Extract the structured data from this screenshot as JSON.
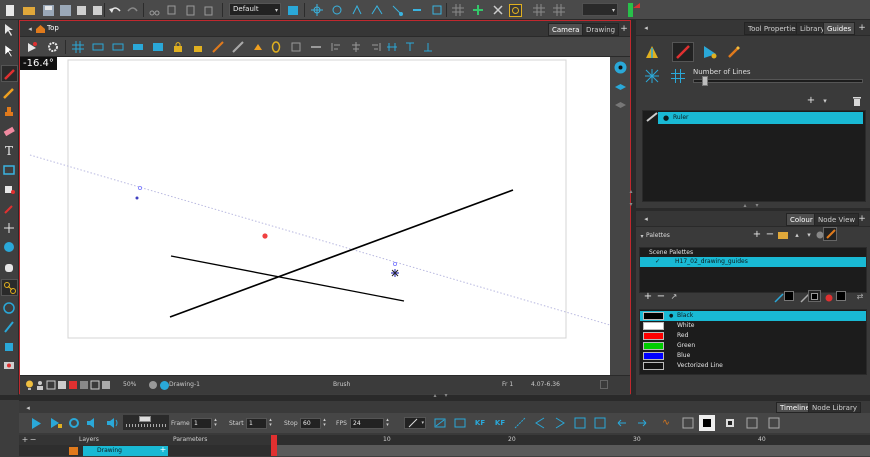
{
  "toolbar": {
    "preset_value": "Default"
  },
  "view": {
    "breadcrumb": "Top",
    "tabs": [
      {
        "label": "Camera",
        "active": true
      },
      {
        "label": "Drawing",
        "active": false
      }
    ],
    "angle_readout": "-16.4°",
    "status": {
      "zoom": "50%",
      "drawing": "Drawing-1",
      "tool": "Brush",
      "frame": "Fr 1",
      "coords": "4.07-6.36"
    }
  },
  "right_top": {
    "tabs": [
      {
        "label": "Tool Properties",
        "active": false
      },
      {
        "label": "Library",
        "active": false
      },
      {
        "label": "Guides",
        "active": true
      }
    ],
    "number_of_lines_label": "Number of Lines",
    "number_of_lines_value": 0.05,
    "guides": [
      {
        "name": "Ruler",
        "selected": true
      }
    ]
  },
  "right_bottom": {
    "tabs": [
      {
        "label": "Colour",
        "active": true
      },
      {
        "label": "Node View",
        "active": false
      }
    ],
    "palettes_label": "Palettes",
    "scene_palettes_label": "Scene Palettes",
    "palettes": [
      {
        "name": "H17_02_drawing_guides",
        "selected": true
      }
    ],
    "colours": [
      {
        "name": "Black",
        "hex": "#000000",
        "selected": true
      },
      {
        "name": "White",
        "hex": "#ffffff",
        "selected": false
      },
      {
        "name": "Red",
        "hex": "#ff0000",
        "selected": false
      },
      {
        "name": "Green",
        "hex": "#00cc00",
        "selected": false
      },
      {
        "name": "Blue",
        "hex": "#0000ff",
        "selected": false
      },
      {
        "name": "Vectorized Line",
        "hex": "#111111",
        "selected": false
      }
    ]
  },
  "timeline": {
    "tabs": [
      {
        "label": "Timeline",
        "active": true
      },
      {
        "label": "Node Library",
        "active": false
      }
    ],
    "frame_label": "Frame",
    "frame_value": "1",
    "start_label": "Start",
    "start_value": "1",
    "stop_label": "Stop",
    "stop_value": "60",
    "fps_label": "FPS",
    "fps_value": "24",
    "layers_header": "Layers",
    "parameters_header": "Parameters",
    "ruler_ticks": [
      "10",
      "20",
      "30",
      "40"
    ],
    "layer_name": "Drawing"
  },
  "colors": {
    "accent": "#19b9d4",
    "active_border": "#c0282e",
    "tool_orange": "#e07a1c"
  }
}
